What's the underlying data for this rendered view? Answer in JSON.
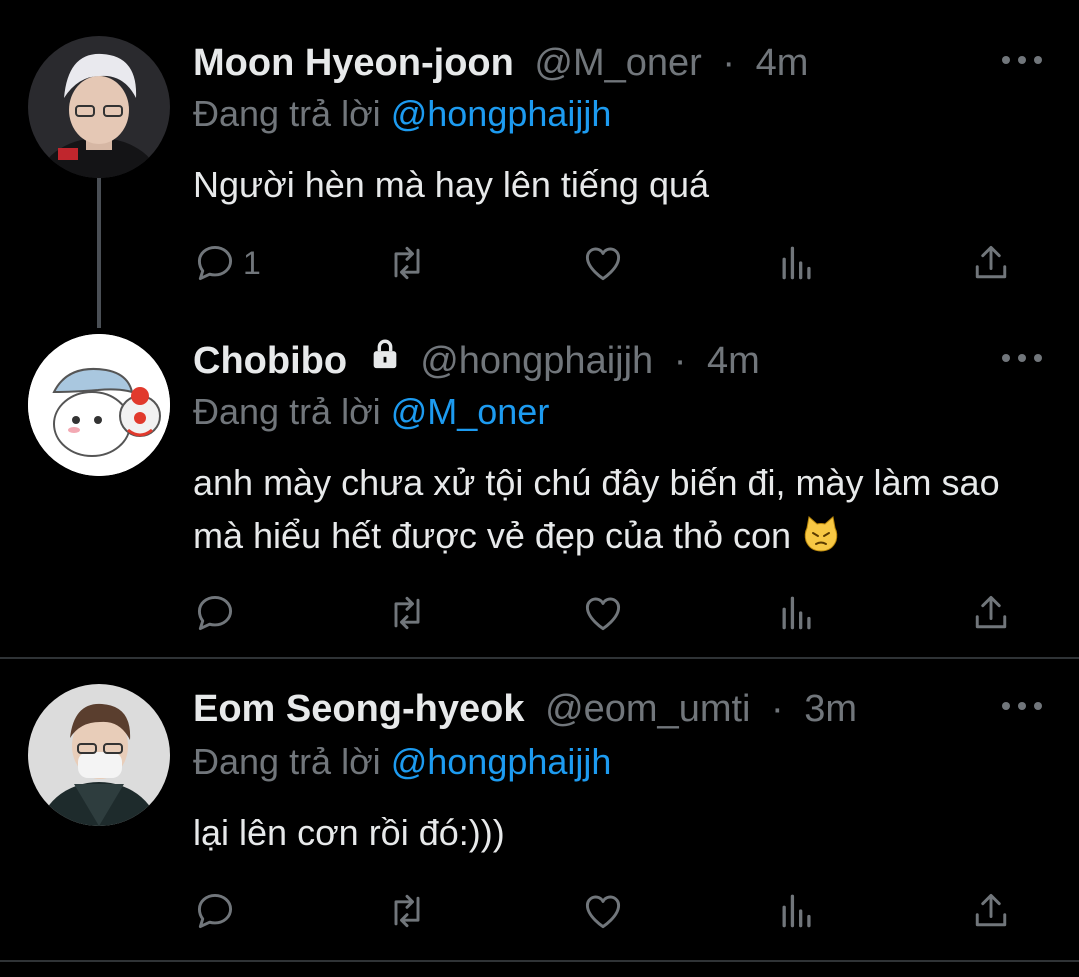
{
  "tweets": [
    {
      "name": "Moon Hyeon-joon",
      "handle": "@M_oner",
      "separator": "·",
      "time": "4m",
      "reply_prefix": "Đang trả lời",
      "reply_mention": "@hongphaijjh",
      "text": "Người hèn mà hay lên tiếng quá",
      "reply_count": "1",
      "avatar_icon": "user-avatar-photo"
    },
    {
      "name": "Chobibo",
      "handle": "@hongphaijjh",
      "separator": "·",
      "time": "4m",
      "reply_prefix": "Đang trả lời",
      "reply_mention": "@M_oner",
      "text": "anh mày chưa xử tội chú đây biến đi, mày làm sao mà hiểu hết được vẻ đẹp của thỏ con",
      "reply_count": "",
      "protected_icon": "lock-icon",
      "emoji": "pouting-cat-emoji",
      "avatar_icon": "cartoon-avatar"
    },
    {
      "name": "Eom Seong-hyeok",
      "handle": "@eom_umti",
      "separator": "·",
      "time": "3m",
      "reply_prefix": "Đang trả lời",
      "reply_mention": "@hongphaijjh",
      "text": "lại lên cơn rồi đó:)))",
      "reply_count": "",
      "avatar_icon": "user-avatar-photo"
    }
  ],
  "colors": {
    "background": "#000000",
    "text": "#e7e9ea",
    "muted": "#71767b",
    "accent": "#1d9bf0",
    "divider": "#2f3336"
  },
  "action_icons": [
    "reply-icon",
    "retweet-icon",
    "like-icon",
    "views-icon",
    "share-icon"
  ]
}
